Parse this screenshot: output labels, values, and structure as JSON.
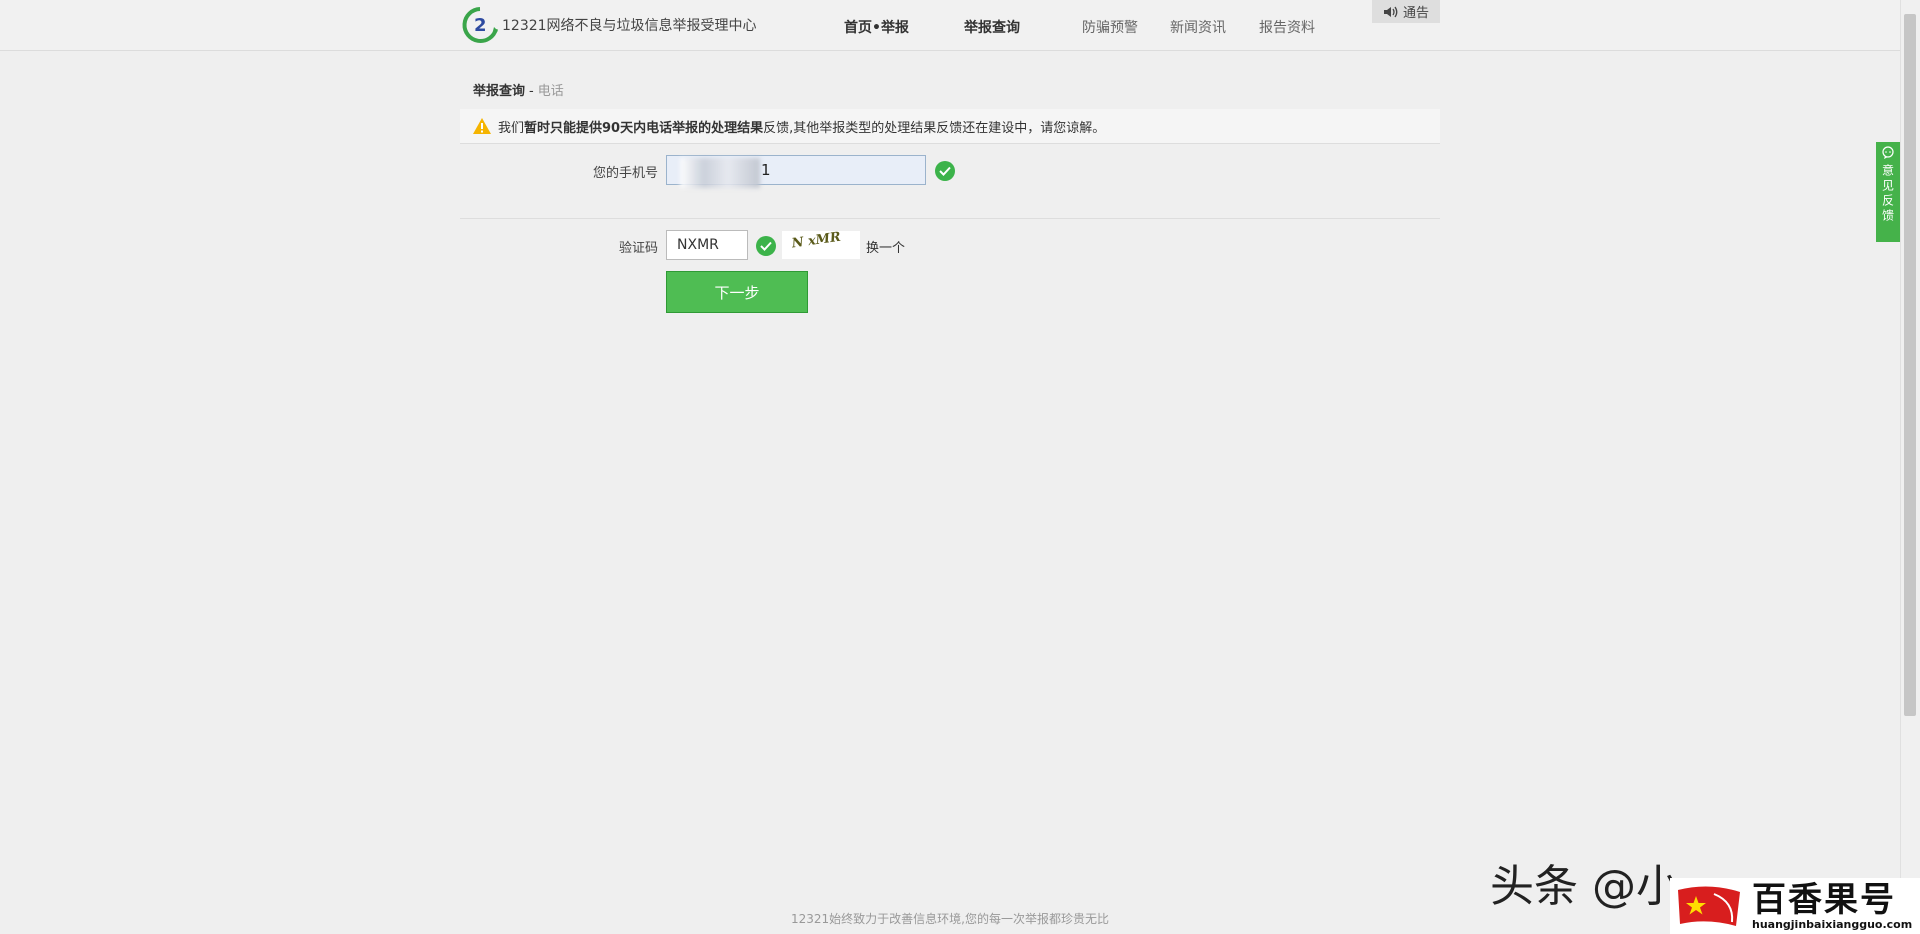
{
  "header": {
    "site_title": "12321网络不良与垃圾信息举报受理中心",
    "nav": [
      "首页•举报",
      "举报查询",
      "防骗预警",
      "新闻资讯",
      "报告资料"
    ],
    "notice_label": "通告"
  },
  "breadcrumb": {
    "section": "举报查询",
    "separator": "-",
    "current": "电话"
  },
  "alert": {
    "prefix": "我们",
    "bold": "暂时只能提供90天内电话举报的处理结果",
    "suffix": "反馈,其他举报类型的处理结果反馈还在建设中，请您谅解。"
  },
  "form": {
    "phone_label": "您的手机号",
    "phone_value_visible": "1",
    "captcha_label": "验证码",
    "captcha_value": "NXMR",
    "captcha_image_text": "N xMR",
    "refresh_label": "换一个",
    "next_button": "下一步"
  },
  "feedback_tab": {
    "label": "意见反馈"
  },
  "footer": {
    "text": "12321始终致力于改善信息环境,您的每一次举报都珍贵无比"
  },
  "watermark": {
    "text": "头条 @小"
  },
  "brand": {
    "name": "百香果号",
    "url": "huangjinbaixiangguo.com"
  },
  "colors": {
    "accent_green": "#4fbd53",
    "check_green": "#3cb34a",
    "warn_yellow": "#f5b400"
  }
}
